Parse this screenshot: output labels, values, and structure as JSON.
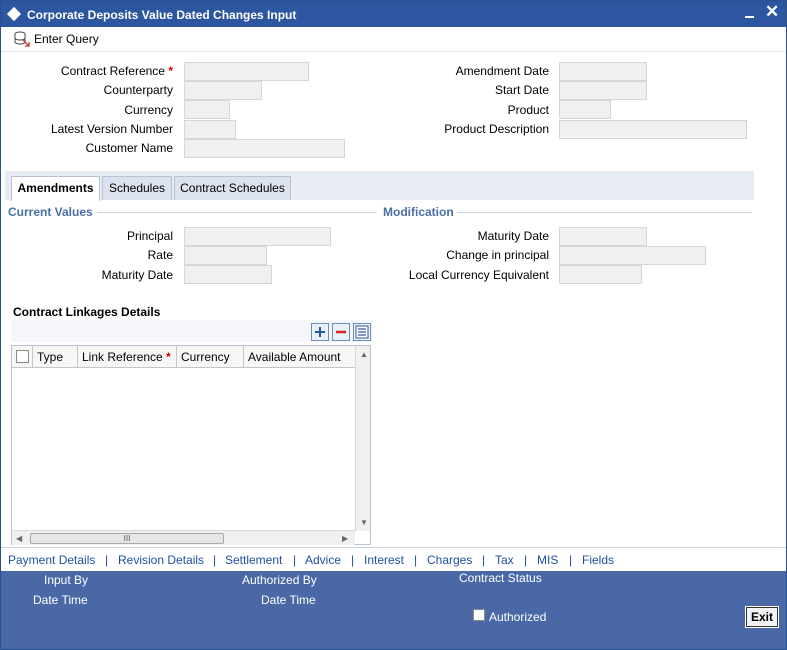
{
  "window": {
    "title": "Corporate Deposits Value Dated Changes Input",
    "min_label": "_",
    "close_label": "✕"
  },
  "toolbar": {
    "enter_query": "Enter Query"
  },
  "header_fields": {
    "contract_reference": "Contract Reference",
    "counterparty": "Counterparty",
    "currency": "Currency",
    "latest_version_number": "Latest Version Number",
    "customer_name": "Customer Name",
    "amendment_date": "Amendment Date",
    "start_date": "Start Date",
    "product": "Product",
    "product_description": "Product Description",
    "required_mark": "*"
  },
  "tabs": [
    {
      "label": "Amendments",
      "active": true
    },
    {
      "label": "Schedules",
      "active": false
    },
    {
      "label": "Contract Schedules",
      "active": false
    }
  ],
  "current_values": {
    "heading": "Current Values",
    "principal": "Principal",
    "rate": "Rate",
    "maturity_date": "Maturity Date"
  },
  "modification": {
    "heading": "Modification",
    "maturity_date": "Maturity Date",
    "change_in_principal": "Change in principal",
    "local_currency_equivalent": "Local Currency Equivalent"
  },
  "linkages": {
    "title": "Contract Linkages Details",
    "columns": [
      "Type",
      "Link Reference",
      "Currency",
      "Available Amount"
    ],
    "required_mark": "*",
    "scroll_thumb": "III"
  },
  "links": [
    "Payment Details",
    "Revision Details",
    "Settlement",
    "Advice",
    "Interest",
    "Charges",
    "Tax",
    "MIS",
    "Fields"
  ],
  "link_separator": "|",
  "footer": {
    "input_by": "Input By",
    "date_time_1": "Date Time",
    "authorized_by": "Authorized By",
    "date_time_2": "Date Time",
    "contract_status": "Contract Status",
    "authorized": "Authorized",
    "exit": "Exit"
  },
  "colors": {
    "titlebar": "#2d56a0",
    "footer": "#4a68a6",
    "link": "#1f4fa0",
    "section": "#4a6fa5"
  }
}
